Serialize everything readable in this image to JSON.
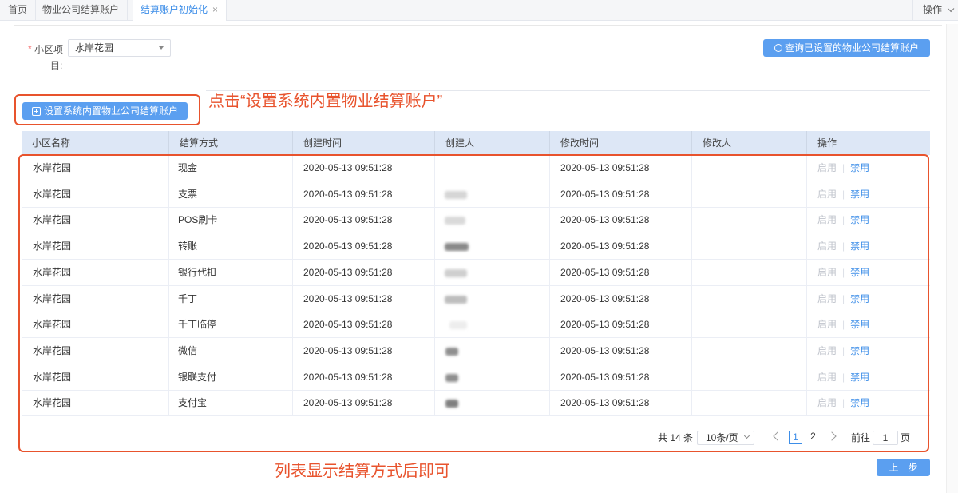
{
  "tabs": [
    {
      "label": "首页"
    },
    {
      "label": "物业公司结算账户"
    },
    {
      "label": "结算账户初始化",
      "close": "×"
    }
  ],
  "tab_ops_label": "操作",
  "filter": {
    "required_mark": "*",
    "label_line1": "小区项",
    "label_line2": "目:",
    "project_value": "水岸花园",
    "query_button": "查询已设置的物业公司结算账户"
  },
  "setup_button": "设置系统内置物业公司结算账户",
  "annotations": {
    "click_hint": "点击“设置系统内置物业结算账户”",
    "done_hint": "列表显示结算方式后即可",
    "color": "#e8532d"
  },
  "table": {
    "columns": [
      "小区名称",
      "结算方式",
      "创建时间",
      "创建人",
      "修改时间",
      "修改人",
      "操作"
    ],
    "rows": [
      {
        "community": "水岸花园",
        "method": "现金",
        "created": "2020-05-13 09:51:28",
        "modified": "2020-05-13 09:51:28"
      },
      {
        "community": "水岸花园",
        "method": "支票",
        "created": "2020-05-13 09:51:28",
        "modified": "2020-05-13 09:51:28"
      },
      {
        "community": "水岸花园",
        "method": "POS刷卡",
        "created": "2020-05-13 09:51:28",
        "modified": "2020-05-13 09:51:28"
      },
      {
        "community": "水岸花园",
        "method": "转账",
        "created": "2020-05-13 09:51:28",
        "modified": "2020-05-13 09:51:28"
      },
      {
        "community": "水岸花园",
        "method": "银行代扣",
        "created": "2020-05-13 09:51:28",
        "modified": "2020-05-13 09:51:28"
      },
      {
        "community": "水岸花园",
        "method": "千丁",
        "created": "2020-05-13 09:51:28",
        "modified": "2020-05-13 09:51:28"
      },
      {
        "community": "水岸花园",
        "method": "千丁临停",
        "created": "2020-05-13 09:51:28",
        "modified": "2020-05-13 09:51:28"
      },
      {
        "community": "水岸花园",
        "method": "微信",
        "created": "2020-05-13 09:51:28",
        "modified": "2020-05-13 09:51:28"
      },
      {
        "community": "水岸花园",
        "method": "银联支付",
        "created": "2020-05-13 09:51:28",
        "modified": "2020-05-13 09:51:28"
      },
      {
        "community": "水岸花园",
        "method": "支付宝",
        "created": "2020-05-13 09:51:28",
        "modified": "2020-05-13 09:51:28"
      }
    ],
    "action_enable": "启用",
    "action_separator": "|",
    "action_disable": "禁用"
  },
  "pagination": {
    "total_text": "共 14 条",
    "page_size": "10条/页",
    "pages": [
      "1",
      "2"
    ],
    "current_page": "1",
    "goto_label": "前往",
    "goto_value": "1",
    "page_unit": "页"
  },
  "prev_button": "上一步",
  "colors": {
    "primary": "#5b9ff0",
    "link": "#3d8ee8",
    "header_bg": "#dde7f6",
    "annotation": "#e8532d"
  }
}
